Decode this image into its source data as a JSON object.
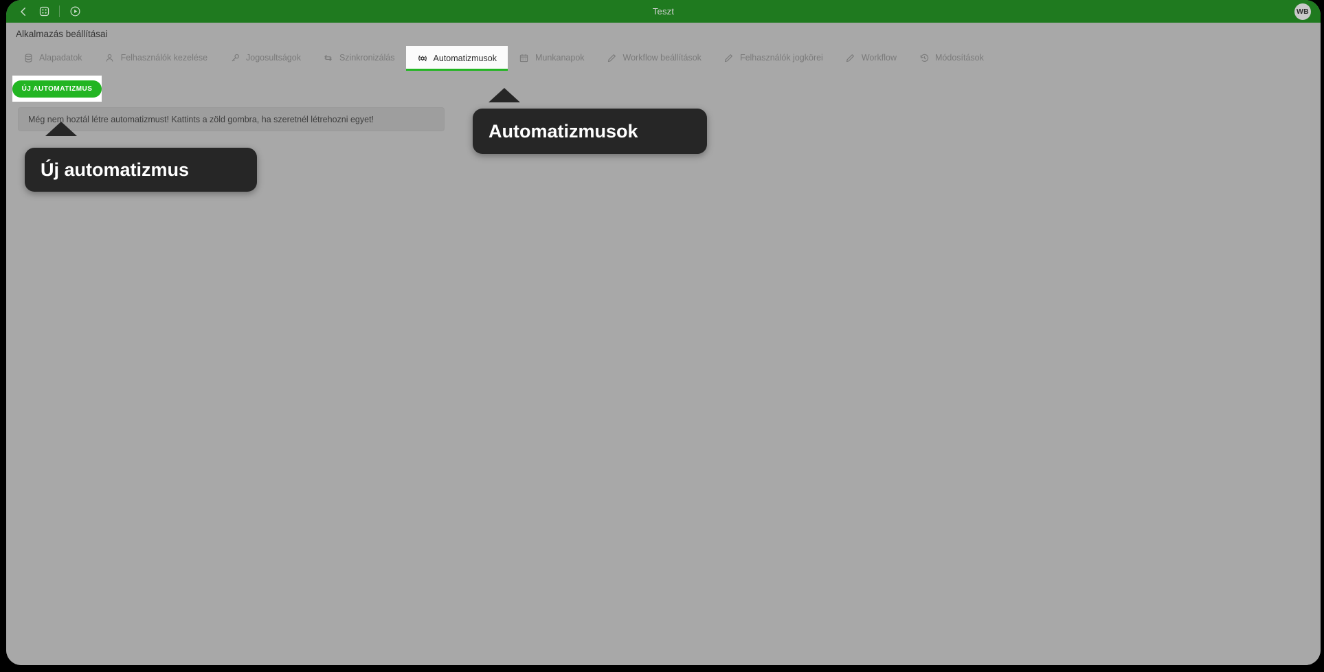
{
  "window": {
    "title": "Teszt",
    "avatar_initials": "WB",
    "accent_green": "#1f7a1f",
    "button_green": "#22b522",
    "background": "#a8a8a8"
  },
  "topbar": {
    "back_label": "Vissza",
    "apps_label": "Alkalmazások",
    "activity_label": "Tevékenység"
  },
  "page": {
    "header_title": "Alkalmazás beállításai"
  },
  "tabs": [
    {
      "label": "Alapadatok",
      "icon": "database-icon",
      "active": false
    },
    {
      "label": "Felhasználók kezelése",
      "icon": "user-icon",
      "active": false
    },
    {
      "label": "Jogosultságok",
      "icon": "key-icon",
      "active": false
    },
    {
      "label": "Szinkronizálás",
      "icon": "sync-icon",
      "active": false
    },
    {
      "label": "Automatizmusok",
      "icon": "automation-icon",
      "active": true
    },
    {
      "label": "Munkanapok",
      "icon": "calendar-icon",
      "active": false
    },
    {
      "label": "Workflow beállítások",
      "icon": "pencil-icon",
      "active": false
    },
    {
      "label": "Felhasználók jogkörei",
      "icon": "pencil-icon",
      "active": false
    },
    {
      "label": "Workflow",
      "icon": "pencil-icon",
      "active": false
    },
    {
      "label": "Módosítások",
      "icon": "history-icon",
      "active": false
    }
  ],
  "main": {
    "new_automation_button": "ÚJ AUTOMATIZMUS",
    "empty_state_message": "Még nem hoztál létre automatizmust! Kattints a zöld gombra, ha szeretnél létrehozni egyet!"
  },
  "tooltips": {
    "new_automation": "Új automatizmus",
    "automations_tab": "Automatizmusok"
  }
}
